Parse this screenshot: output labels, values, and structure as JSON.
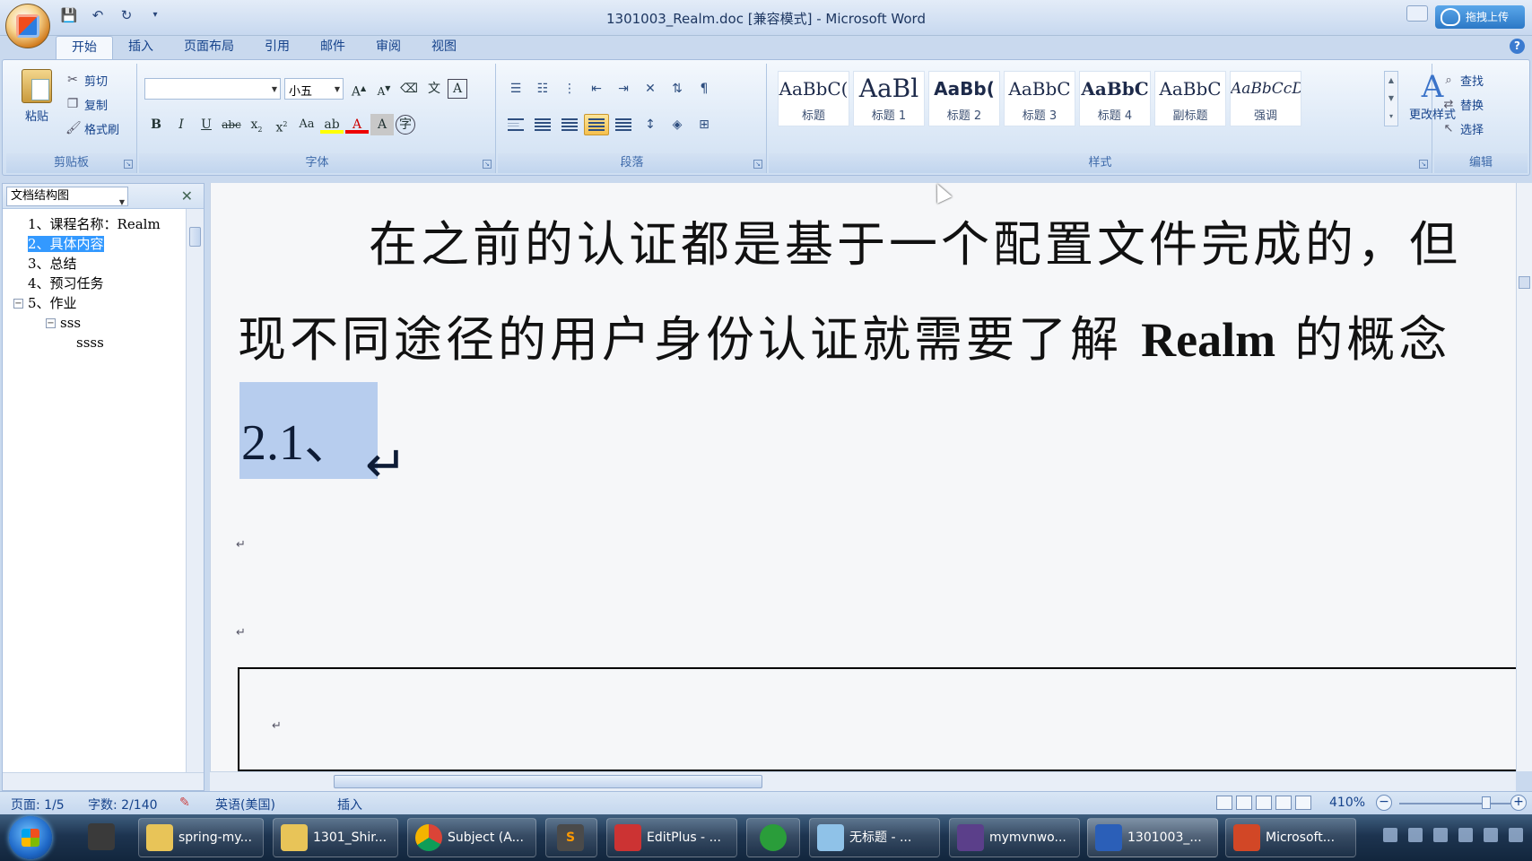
{
  "window": {
    "title": "1301003_Realm.doc [兼容模式] - Microsoft Word",
    "upload_label": "拖拽上传"
  },
  "ribbon": {
    "tabs": [
      "开始",
      "插入",
      "页面布局",
      "引用",
      "邮件",
      "审阅",
      "视图"
    ],
    "active_tab": "开始",
    "clipboard": {
      "label": "剪贴板",
      "paste": "粘贴",
      "cut": "剪切",
      "copy": "复制",
      "format_painter": "格式刷"
    },
    "font": {
      "label": "字体",
      "font_name": "",
      "font_size": "小五"
    },
    "paragraph": {
      "label": "段落"
    },
    "styles": {
      "label": "样式",
      "items": [
        {
          "sample": "AaBbC(",
          "name": "标题"
        },
        {
          "sample": "AaBl",
          "name": "标题 1"
        },
        {
          "sample": "AaBb(",
          "name": "标题 2"
        },
        {
          "sample": "AaBbC",
          "name": "标题 3"
        },
        {
          "sample": "AaBbC",
          "name": "标题 4"
        },
        {
          "sample": "AaBbC",
          "name": "副标题"
        },
        {
          "sample": "AaBbCcD",
          "name": "强调"
        }
      ],
      "change_styles": "更改样式"
    },
    "editing": {
      "label": "编辑",
      "find": "查找",
      "replace": "替换",
      "select": "选择"
    }
  },
  "nav_pane": {
    "mode": "文档结构图",
    "items": [
      {
        "text": "1、课程名称：Realm"
      },
      {
        "text": "2、具体内容"
      },
      {
        "text": "3、总结"
      },
      {
        "text": "4、预习任务"
      },
      {
        "text": "5、作业"
      },
      {
        "text": "sss"
      },
      {
        "text": "ssss"
      }
    ]
  },
  "document": {
    "line1": "在之前的认证都是基于一个配置文件完成的，但",
    "line2_cjk": "现不同途径的用户身份认证就需要了解 ",
    "line2_latin": "Realm",
    "line2_end": " 的概念",
    "heading": "2.1、",
    "para_mark": "↵"
  },
  "status_bar": {
    "page": "页面: 1/5",
    "words": "字数: 2/140",
    "language": "英语(美国)",
    "mode": "插入",
    "zoom": "410%"
  },
  "taskbar": {
    "items": [
      {
        "label": "spring-my...",
        "icon": "folder-icon"
      },
      {
        "label": "1301_Shir...",
        "icon": "folder-icon"
      },
      {
        "label": "Subject (A...",
        "icon": "chrome-icon"
      },
      {
        "label": "",
        "icon": "sublime-icon"
      },
      {
        "label": "EditPlus - ...",
        "icon": "editplus-icon"
      },
      {
        "label": "",
        "icon": "green-app-icon"
      },
      {
        "label": "无标题 - ...",
        "icon": "paint-icon"
      },
      {
        "label": "mymvnwo...",
        "icon": "java-ee-ide-icon"
      },
      {
        "label": "1301003_...",
        "icon": "word-doc-icon"
      },
      {
        "label": "Microsoft...",
        "icon": "powerpoint-icon"
      }
    ]
  }
}
